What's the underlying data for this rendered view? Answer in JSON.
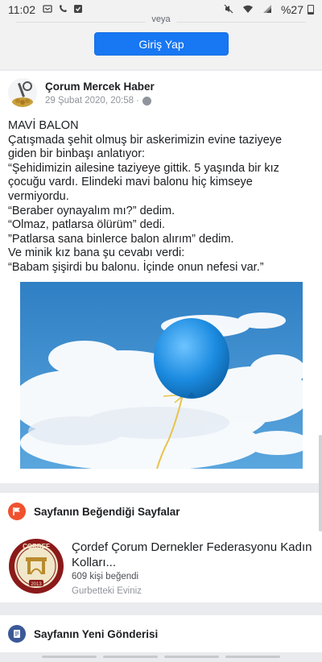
{
  "status_bar": {
    "time": "11:02",
    "battery": "%27"
  },
  "login": {
    "separator": "veya",
    "button_label": "Giriş Yap"
  },
  "post": {
    "page_name": "Çorum Mercek Haber",
    "date": "29 Şubat 2020, 20:58 ·",
    "lines": [
      "MAVİ BALON",
      "Çatışmada şehit olmuş bir askerimizin evine taziyeye",
      "giden bir binbaşı anlatıyor:",
      "“Şehidimizin ailesine taziyeye gittik. 5 yaşında bir kız",
      "çocuğu vardı. Elindeki mavi balonu hiç kimseye",
      "vermiyordu.",
      "“Beraber oynayalım mı?” dedim.",
      "“Olmaz, patlarsa ölürüm” dedi.",
      "”Patlarsa sana binlerce balon alırım” dedim.",
      "Ve minik kız bana şu cevabı verdi:",
      "“Babam şişirdi bu balonu. İçinde onun nefesi var.”"
    ]
  },
  "liked_pages": {
    "title": "Sayfanın Beğendiği Sayfalar",
    "items": [
      {
        "name": "Çordef Çorum Dernekler Federasyonu Kadın Kolları...",
        "likes": "609 kişi beğendi",
        "subtitle": "Gurbetteki Eviniz",
        "logo_text": "ÇORDEF",
        "logo_year": "2013"
      }
    ]
  },
  "new_post": {
    "title": "Sayfanın Yeni Gönderisi"
  },
  "colors": {
    "accent": "#1877f2",
    "flag_icon": "#f0512e",
    "doc_icon": "#3b5998"
  }
}
